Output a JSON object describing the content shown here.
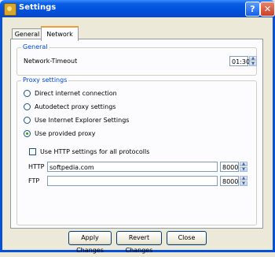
{
  "window": {
    "title": "Settings"
  },
  "tabs": [
    {
      "label": "General"
    },
    {
      "label": "Network"
    }
  ],
  "general": {
    "legend": "General",
    "timeout_label": "Network-Timeout",
    "timeout_value": "01:30"
  },
  "proxy": {
    "legend": "Proxy settings",
    "options": [
      {
        "label": "Direct internet connection",
        "selected": false
      },
      {
        "label": "Autodetect proxy settings",
        "selected": false
      },
      {
        "label": "Use Internet Explorer Settings",
        "selected": false
      },
      {
        "label": "Use provided proxy",
        "selected": true
      }
    ],
    "http_for_all_label": "Use HTTP settings for all protocolls",
    "http_for_all_checked": false,
    "http": {
      "label": "HTTP",
      "host": "softpedia.com",
      "port": "8000"
    },
    "ftp": {
      "label": "FTP",
      "host": "",
      "port": "8000"
    }
  },
  "buttons": {
    "apply": "Apply Changes",
    "revert": "Revert Changes",
    "close": "Close"
  },
  "colors": {
    "accent": "#0046d5",
    "titlebar": "#0050dc",
    "selected_radio": "#21a121"
  }
}
